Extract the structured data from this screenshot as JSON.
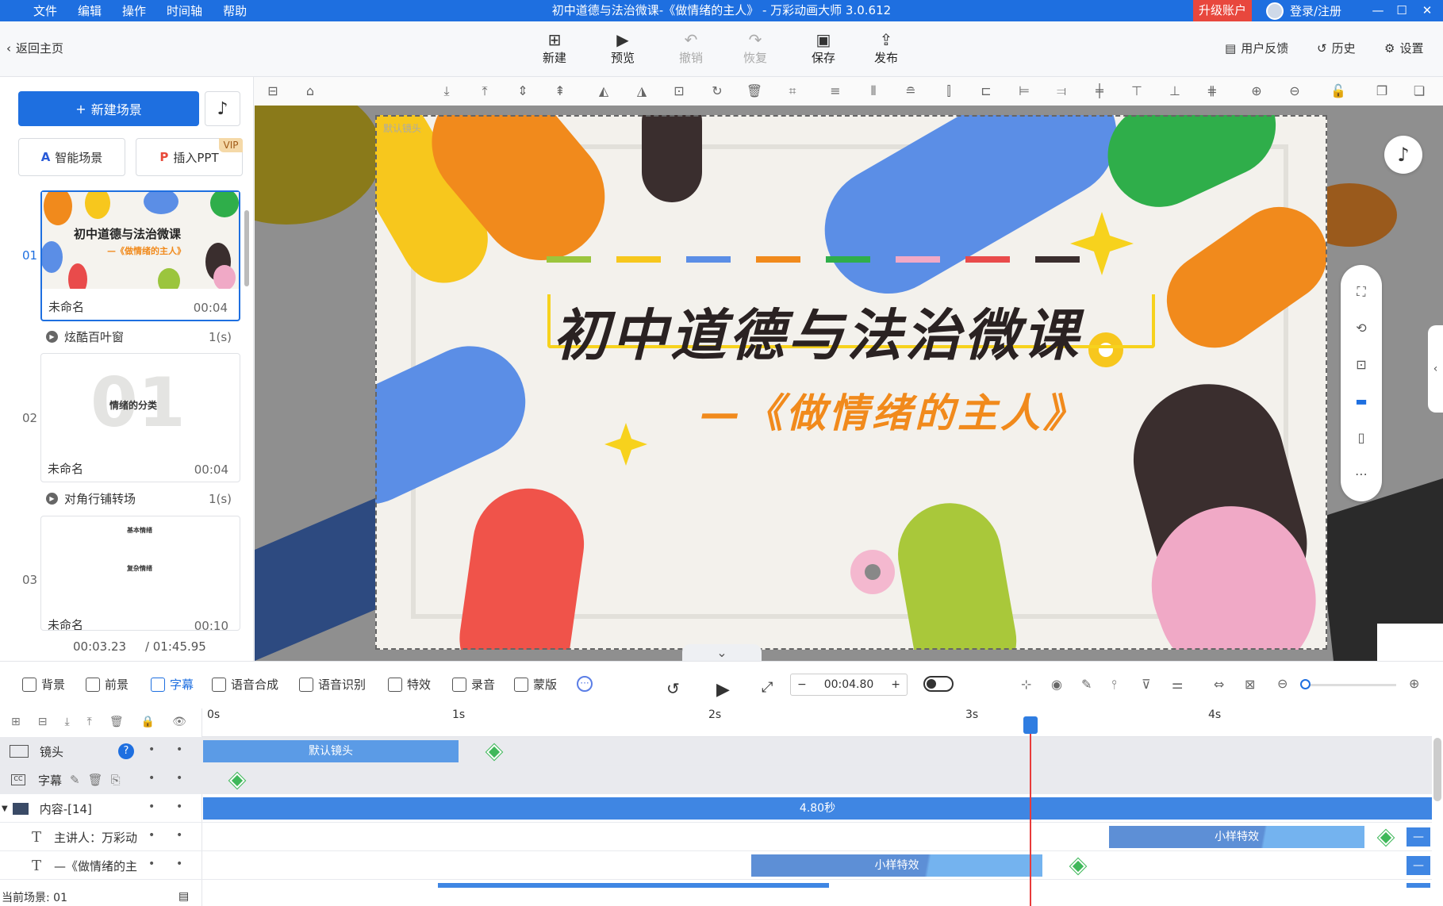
{
  "window": {
    "menu": [
      "文件",
      "编辑",
      "操作",
      "时间轴",
      "帮助"
    ],
    "title": "初中道德与法治微课-《做情绪的主人》 - 万彩动画大师 3.0.612",
    "upgrade": "升级账户",
    "login": "登录/注册"
  },
  "toolbar": {
    "back": "返回主页",
    "buttons": [
      {
        "label": "新建",
        "icon": "plus-box-icon"
      },
      {
        "label": "预览",
        "icon": "play-icon"
      },
      {
        "label": "撤销",
        "icon": "undo-icon"
      },
      {
        "label": "恢复",
        "icon": "redo-icon"
      },
      {
        "label": "保存",
        "icon": "save-icon"
      },
      {
        "label": "发布",
        "icon": "publish-icon"
      }
    ],
    "feedback": "用户反馈",
    "history": "历史",
    "settings": "设置"
  },
  "left": {
    "new_scene": "新建场景",
    "smart_scene": "智能场景",
    "insert_ppt": "插入PPT",
    "vip": "VIP",
    "scenes": [
      {
        "num": "01",
        "name": "未命名",
        "dur": "00:04",
        "title": "初中道德与法治微课",
        "subtitle": "—《做情绪的主人》"
      },
      {
        "num": "02",
        "name": "未命名",
        "dur": "00:04",
        "big": "01",
        "caption": "情绪的分类"
      },
      {
        "num": "03",
        "name": "未命名",
        "dur": "00:10",
        "top": "基本情绪",
        "mid": "复杂情绪"
      }
    ],
    "transitions": [
      {
        "name": "炫酷百叶窗",
        "time": "1(s)"
      },
      {
        "name": "对角行铺转场",
        "time": "1(s)"
      }
    ],
    "current_time": "00:03.23",
    "total_time": "/ 01:45.95"
  },
  "canvas": {
    "camera_label": "默认镜头",
    "title": "初中道德与法治微课",
    "subtitle": "—《做情绪的主人》",
    "colors": [
      "#9bc53d",
      "#f7c71d",
      "#5b8ee6",
      "#f18a1c",
      "#2fae4a",
      "#f0a9c6",
      "#e94b4b",
      "#3a2e2e"
    ]
  },
  "bottom": {
    "tools": [
      "背景",
      "前景",
      "字幕",
      "语音合成",
      "语音识别",
      "特效",
      "录音",
      "蒙版"
    ],
    "active_tool": "字幕",
    "time_value": "00:04.80",
    "minus": "−",
    "plus": "+"
  },
  "timeline": {
    "ticks": [
      "0s",
      "1s",
      "2s",
      "3s",
      "4s"
    ],
    "rows": [
      {
        "label": "镜头",
        "bar": "默认镜头"
      },
      {
        "label": "字幕"
      },
      {
        "label": "内容-[14]",
        "bar": "4.80秒"
      },
      {
        "label": "主讲人：万彩动",
        "bar": "小样特效"
      },
      {
        "label": "—《做情绪的主",
        "bar": "小样特效"
      }
    ],
    "status": "当前场景: 01"
  }
}
